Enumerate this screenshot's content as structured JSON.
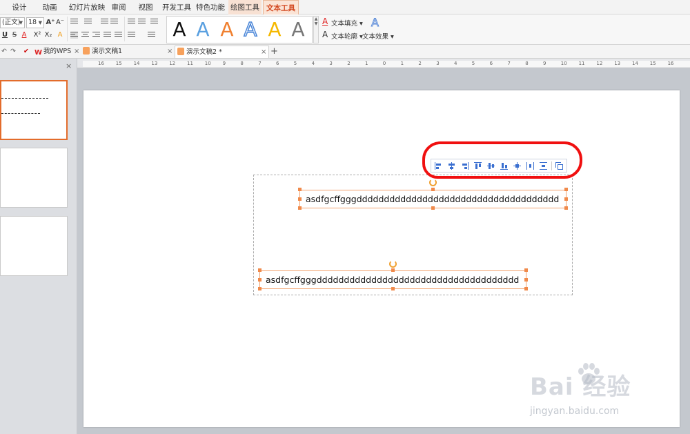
{
  "menu_tabs": [
    "设计",
    "动画",
    "幻灯片放映",
    "审阅",
    "视图",
    "开发工具",
    "特色功能",
    "绘图工具",
    "文本工具"
  ],
  "ribbon": {
    "font_name": "(正文)",
    "font_size": "18",
    "grow_font": "A⁺",
    "shrink_font": "A⁻",
    "underline": "U",
    "strikethrough": "S",
    "font_color": "A",
    "superscript": "X²",
    "subscript": "X₂",
    "clear_format": "A",
    "text_fill": "文本填充",
    "text_outline": "文本轮廓",
    "text_effect": "文本效果",
    "gallery_glyph": "A"
  },
  "doc_tabs": {
    "wps": "我的WPS",
    "doc1": "演示文稿1",
    "doc2": "演示文稿2 *",
    "new_tab": "+"
  },
  "ruler_labels": [
    "16",
    "15",
    "14",
    "13",
    "12",
    "11",
    "10",
    "9",
    "8",
    "7",
    "6",
    "5",
    "4",
    "3",
    "2",
    "1",
    "0",
    "1",
    "2",
    "3",
    "4",
    "5",
    "6",
    "7",
    "8",
    "9",
    "10",
    "11",
    "12",
    "13",
    "14",
    "15",
    "16"
  ],
  "slide": {
    "textbox1": "asdfgcffgggddddddddddddddddddddddddddddddddddddd",
    "textbox2": "asdfgcffgggddddddddddddddddddddddddddddddddddddd"
  },
  "watermark": {
    "brand": "Bai  经验",
    "url": "jingyan.baidu.com"
  },
  "colors": {
    "accent": "#d2461e",
    "selection": "#f08a4b",
    "annotation": "#f01010"
  }
}
